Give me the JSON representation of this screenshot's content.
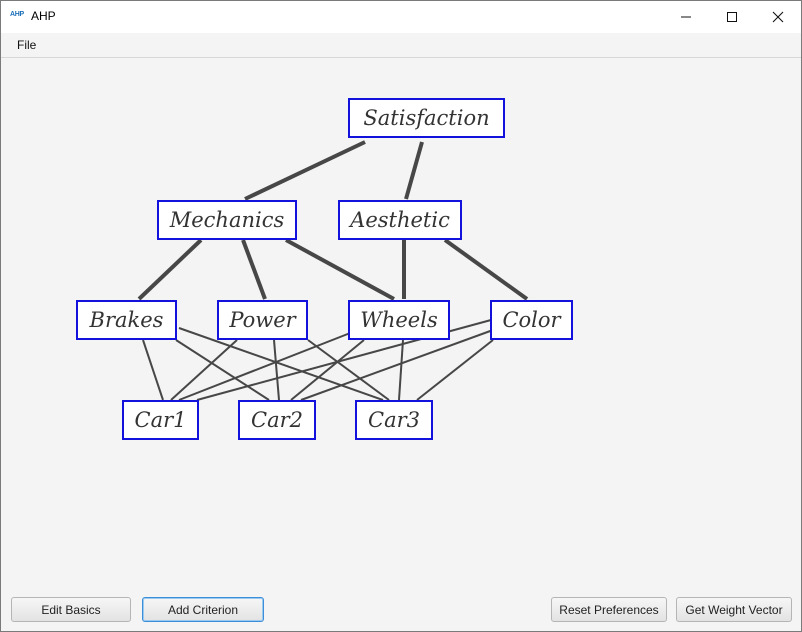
{
  "window": {
    "title": "AHP",
    "app_icon_text": "AHP"
  },
  "menubar": {
    "items": [
      {
        "label": "File"
      }
    ]
  },
  "hierarchy": {
    "goal": "Satisfaction",
    "criteria": [
      "Mechanics",
      "Aesthetic"
    ],
    "subcriteria": [
      "Brakes",
      "Power",
      "Wheels",
      "Color"
    ],
    "alternatives": [
      "Car1",
      "Car2",
      "Car3"
    ]
  },
  "colors": {
    "node_border": "#1212dc",
    "edge": "#474747",
    "background": "#f4f4f4"
  },
  "buttons": {
    "edit_basics": "Edit Basics",
    "add_criterion": "Add Criterion",
    "reset_preferences": "Reset Preferences",
    "get_weight_vector": "Get Weight Vector"
  }
}
